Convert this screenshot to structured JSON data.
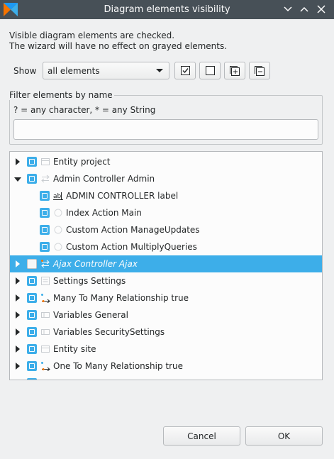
{
  "window": {
    "title": "Diagram elements visibility"
  },
  "description": {
    "line1": "Visible diagram elements are checked.",
    "line2": "The wizard will have no effect on grayed elements."
  },
  "show": {
    "label": "Show",
    "selected": "all elements"
  },
  "filter": {
    "group_title": "Filter elements by name",
    "hint": "? = any character, * = any String",
    "value": "",
    "placeholder": ""
  },
  "tree": {
    "items": [
      {
        "label": "Entity project",
        "expander": "closed",
        "checked": true,
        "icon": "entity-icon"
      },
      {
        "label": "Admin Controller Admin",
        "expander": "open",
        "checked": true,
        "icon": "controller-icon"
      },
      {
        "label": "ADMIN CONTROLLER label",
        "expander": "none",
        "checked": true,
        "icon": "label-icon"
      },
      {
        "label": "Index Action Main",
        "expander": "none",
        "checked": true,
        "icon": "action-icon"
      },
      {
        "label": "Custom Action ManageUpdates",
        "expander": "none",
        "checked": true,
        "icon": "action-icon"
      },
      {
        "label": "Custom Action MultiplyQueries",
        "expander": "none",
        "checked": true,
        "icon": "action-icon"
      },
      {
        "label": "Ajax Controller Ajax",
        "expander": "closed",
        "checked": false,
        "selected": true,
        "icon": "ajax-controller-icon"
      },
      {
        "label": "Settings Settings",
        "expander": "closed",
        "checked": true,
        "icon": "settings-icon"
      },
      {
        "label": "Many To Many Relationship true",
        "expander": "closed",
        "checked": true,
        "icon": "relationship-icon"
      },
      {
        "label": "Variables General",
        "expander": "closed",
        "checked": true,
        "icon": "variables-icon"
      },
      {
        "label": "Variables SecuritySettings",
        "expander": "closed",
        "checked": true,
        "icon": "variables-icon"
      },
      {
        "label": "Entity site",
        "expander": "closed",
        "checked": true,
        "icon": "entity-icon"
      },
      {
        "label": "One To Many Relationship true",
        "expander": "closed",
        "checked": true,
        "icon": "relationship-icon"
      }
    ]
  },
  "buttons": {
    "cancel": "Cancel",
    "ok": "OK"
  },
  "colors": {
    "accent": "#3daee9",
    "titlebar": "#475057",
    "window_bg": "#eff0f1"
  }
}
